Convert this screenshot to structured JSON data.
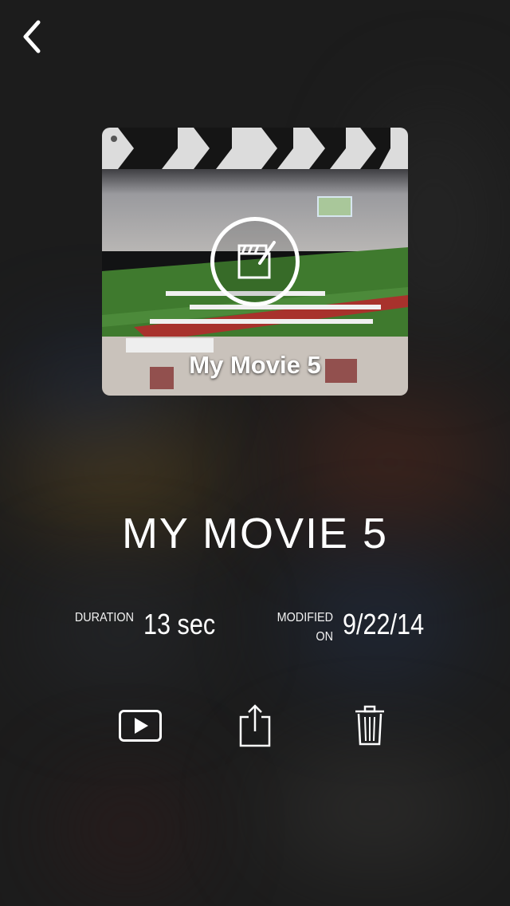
{
  "nav": {
    "back_icon": "chevron-left-icon"
  },
  "thumbnail": {
    "overlay_title": "My Movie 5",
    "center_icon": "clapperboard-edit-icon"
  },
  "movie": {
    "title": "MY MOVIE 5",
    "duration_label": "DURATION",
    "duration_value": "13 sec",
    "modified_label_line1": "MODIFIED",
    "modified_label_line2": "ON",
    "modified_value": "9/22/14"
  },
  "actions": [
    {
      "name": "play",
      "icon": "play-icon"
    },
    {
      "name": "share",
      "icon": "share-icon"
    },
    {
      "name": "delete",
      "icon": "trash-icon"
    }
  ]
}
